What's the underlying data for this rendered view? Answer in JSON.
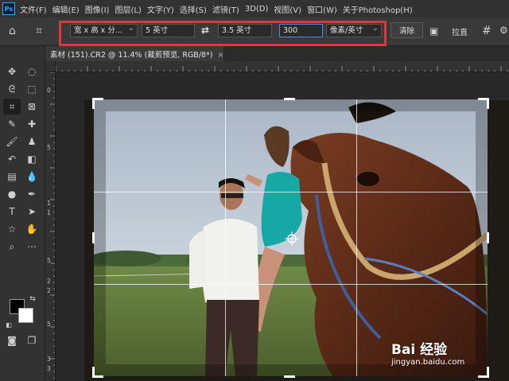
{
  "app": {
    "logo": "Ps"
  },
  "menu": [
    "文件(F)",
    "编辑(E)",
    "图像(I)",
    "图层(L)",
    "文字(Y)",
    "选择(S)",
    "滤镜(T)",
    "3D(D)",
    "视图(V)",
    "窗口(W)",
    "关于Photoshop(H)"
  ],
  "options": {
    "ratio_preset": "宽 x 高 x 分...",
    "width_value": "5 英寸",
    "height_value": "3.5 英寸",
    "resolution_value": "300",
    "resolution_unit": "像素/英寸",
    "clear_label": "清除",
    "straighten_label": "拉直"
  },
  "document": {
    "tab_title": "素材 (151).CR2 @ 11.4% (裁剪预览, RGB/8*)",
    "close_glyph": "×"
  },
  "rulers": {
    "left_labels": [
      "0",
      "5",
      "1",
      "1",
      "5",
      "2",
      "2",
      "5",
      "3",
      "3"
    ]
  },
  "watermark": {
    "logo": "Bai  经验",
    "url": "jingyan.baidu.com"
  },
  "colors": {
    "highlight_border": "#e8313a",
    "foreground": "#000000",
    "background": "#ffffff"
  }
}
